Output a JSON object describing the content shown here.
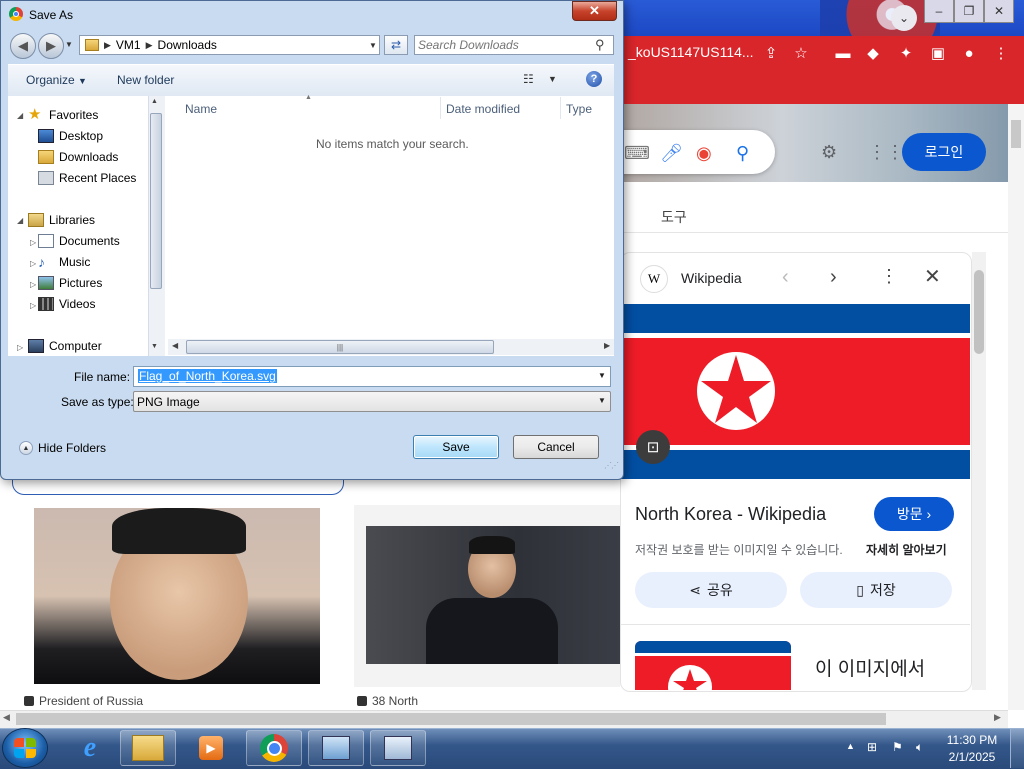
{
  "browser": {
    "omnibox_text": "_koUS1147US114...",
    "login_label": "로그인",
    "tools_tab": "도구",
    "knowledge_panel": {
      "source": "Wikipedia",
      "source_badge": "W",
      "title": "North Korea - Wikipedia",
      "visit_label": "방문",
      "copyright_notice": "저작권 보호를 받는 이미지일 수 있습니다.",
      "learn_more": "자세히 알아보기",
      "share_label": "공유",
      "save_label": "저장",
      "in_this_image": "이 이미지에서",
      "flag_colors": {
        "blue": "#024fa2",
        "red": "#ed1c27",
        "white": "#ffffff"
      }
    },
    "results": [
      {
        "caption": "President of Russia"
      },
      {
        "caption": "38 North"
      }
    ],
    "accent_color": "#d9262b",
    "button_color": "#0b57d0"
  },
  "dialog": {
    "title": "Save As",
    "breadcrumb": [
      "VM1",
      "Downloads"
    ],
    "search_placeholder": "Search Downloads",
    "toolbar": {
      "organize": "Organize",
      "new_folder": "New folder"
    },
    "nav": {
      "favorites": "Favorites",
      "favorites_items": [
        "Desktop",
        "Downloads",
        "Recent Places"
      ],
      "libraries": "Libraries",
      "libraries_items": [
        "Documents",
        "Music",
        "Pictures",
        "Videos"
      ],
      "computer": "Computer"
    },
    "columns": [
      "Name",
      "Date modified",
      "Type"
    ],
    "empty_message": "No items match your search.",
    "file_name_label": "File name:",
    "file_name_value": "Flag_of_North_Korea.svg",
    "save_type_label": "Save as type:",
    "save_type_value": "PNG Image",
    "hide_folders": "Hide Folders",
    "save_button": "Save",
    "cancel_button": "Cancel"
  },
  "taskbar": {
    "time": "11:30 PM",
    "date": "2/1/2025",
    "pinned": [
      "internet-explorer",
      "windows-explorer",
      "media-player",
      "chrome",
      "network-tool",
      "control-panel"
    ]
  }
}
